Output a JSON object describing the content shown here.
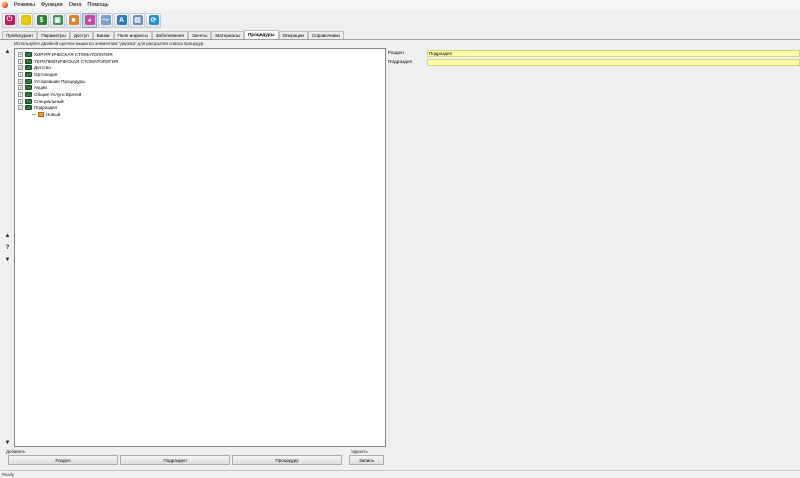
{
  "menu": [
    "Режимы",
    "Функции",
    "Окна",
    "Помощь"
  ],
  "toolbar": {
    "icons": [
      {
        "name": "exit-icon",
        "color": "#c2185b",
        "glyph": "⏻"
      },
      {
        "name": "smiley-icon",
        "color": "#e6c200",
        "glyph": "☺"
      },
      {
        "name": "money-icon",
        "color": "#2e7d32",
        "glyph": "$"
      },
      {
        "name": "picture-icon",
        "color": "#3f8f4f",
        "glyph": "▣"
      },
      {
        "name": "box-icon",
        "color": "#d9822b",
        "glyph": "■"
      },
      {
        "name": "chart-icon",
        "color": "#c84a9c",
        "glyph": "◕"
      },
      {
        "name": "wave-icon",
        "color": "#7aa0c8",
        "glyph": "〜"
      },
      {
        "name": "font-icon",
        "color": "#2a7bbd",
        "glyph": "A"
      },
      {
        "name": "print-icon",
        "color": "#6a8fb5",
        "glyph": "▤"
      },
      {
        "name": "refresh-icon",
        "color": "#2a8fd0",
        "glyph": "⟳"
      }
    ],
    "active_index": 5
  },
  "tabs": [
    "Прейскурант",
    "Параметры",
    "Доступ",
    "Банки",
    "Поле индексы",
    "Заболевания",
    "Зачеты",
    "Материалы",
    "Процедуры",
    "Операции",
    "Справочники"
  ],
  "active_tab": 8,
  "hint": "Используйте двойной щелчок мыши по элементам \"дерева\" для раскрытия списка процедур.",
  "tree": [
    {
      "label": "ХИРУРГИЧЕСКАЯ СТОМАТОЛОГИЯ",
      "expander": "+"
    },
    {
      "label": "ТЕРАПЕВТИЧЕСКАЯ СТОМАТОЛОГИЯ",
      "expander": "+"
    },
    {
      "label": "Детство",
      "expander": "+"
    },
    {
      "label": "Ортопедия",
      "expander": "+"
    },
    {
      "label": "Устаревшие Процедуры",
      "expander": "+"
    },
    {
      "label": "Акции",
      "expander": "+"
    },
    {
      "label": "Общие Услуги Врачей",
      "expander": "+"
    },
    {
      "label": "Специальный",
      "expander": "+"
    },
    {
      "label": "Подраздел",
      "expander": "−"
    }
  ],
  "tree_child": {
    "label": "Новый"
  },
  "props": {
    "section_label": "Раздел",
    "section_value": "Подраздел",
    "subsection_label": "Подраздел",
    "subsection_value": ""
  },
  "bottom": {
    "add_label": "Добавить",
    "delete_label": "Удалить",
    "btn_section": "Раздел",
    "btn_subsection": "Подраздел",
    "btn_procedure": "Процедуру",
    "btn_record": "Запись"
  },
  "status": "Ready"
}
